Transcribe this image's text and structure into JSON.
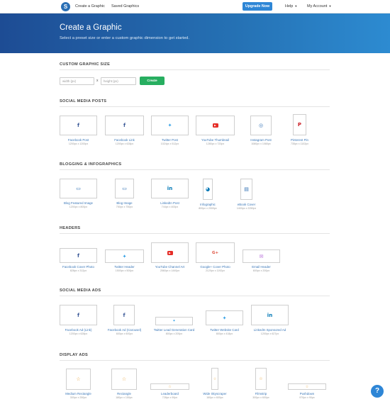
{
  "nav": {
    "logo": "S",
    "create": "Create a Graphic",
    "saved": "Saved Graphics",
    "upgrade": "Upgrade Now",
    "help": "Help",
    "account": "My Account"
  },
  "hero": {
    "title": "Create a Graphic",
    "subtitle": "Select a preset size or enter a custom graphic dimension to get started."
  },
  "custom": {
    "title": "CUSTOM GRAPHIC SIZE",
    "width_placeholder": "width (px)",
    "times": "x",
    "height_placeholder": "height (px)",
    "create": "Create"
  },
  "sections": {
    "social": {
      "title": "SOCIAL MEDIA POSTS",
      "items": [
        {
          "label": "Facebook Post",
          "dim": "1200px x 1200px",
          "icon": "facebook-icon"
        },
        {
          "label": "Facebook Link",
          "dim": "1200px x 628px",
          "icon": "facebook-icon"
        },
        {
          "label": "Twitter Post",
          "dim": "1024px x 512px",
          "icon": "twitter-icon"
        },
        {
          "label": "YouTube Thumbnail",
          "dim": "1280px x 720px",
          "icon": "youtube-icon"
        },
        {
          "label": "Instagram Post",
          "dim": "1080px x 1080px",
          "icon": "instagram-icon"
        },
        {
          "label": "Pinterest Pin",
          "dim": "735px x 1102px",
          "icon": "pinterest-icon"
        }
      ]
    },
    "blogging": {
      "title": "BLOGGING & INFOGRAPHICS",
      "items": [
        {
          "label": "Blog Featured Image",
          "dim": "1200px x 800px",
          "icon": "monitor-icon"
        },
        {
          "label": "Blog Image",
          "dim": "750px x 750px",
          "icon": "monitor-icon"
        },
        {
          "label": "LinkedIn Post",
          "dim": "744px x 400px",
          "icon": "linkedin-icon"
        },
        {
          "label": "Infographic",
          "dim": "800px x 2000px",
          "icon": "pie-chart-icon"
        },
        {
          "label": "eBook Cover",
          "dim": "1400px x 2250px",
          "icon": "book-icon"
        }
      ]
    },
    "headers": {
      "title": "HEADERS",
      "items": [
        {
          "label": "Facebook Cover Photo",
          "dim": "828px x 312px",
          "icon": "facebook-icon"
        },
        {
          "label": "Twitter Header",
          "dim": "1500px x 500px",
          "icon": "twitter-icon"
        },
        {
          "label": "YouTube Channel Art",
          "dim": "2560px x 1440px",
          "icon": "youtube-icon"
        },
        {
          "label": "Google+ Cover Photo",
          "dim": "2120px x 1192px",
          "icon": "google-plus-icon"
        },
        {
          "label": "Email Header",
          "dim": "600px x 200px",
          "icon": "email-icon"
        }
      ]
    },
    "ads": {
      "title": "SOCIAL MEDIA ADS",
      "items": [
        {
          "label": "Facebook Ad (Link)",
          "dim": "1200px x 628px",
          "icon": "facebook-icon"
        },
        {
          "label": "Facebook Ad (Carousel)",
          "dim": "600px x 600px",
          "icon": "facebook-icon"
        },
        {
          "label": "Twitter Lead Generation Card",
          "dim": "800px x 200px",
          "icon": "twitter-icon"
        },
        {
          "label": "Twitter Website Card",
          "dim": "800px x 418px",
          "icon": "twitter-icon"
        },
        {
          "label": "LinkedIn Sponsored Ad",
          "dim": "1200px x 627px",
          "icon": "linkedin-icon"
        }
      ]
    },
    "display": {
      "title": "DISPLAY ADS",
      "items": [
        {
          "label": "Medium Rectangle",
          "dim": "300px x 250px",
          "icon": "star-icon"
        },
        {
          "label": "Rectangle",
          "dim": "180px x 150px",
          "icon": "star-icon"
        },
        {
          "label": "Leaderboard",
          "dim": "728px x 90px",
          "icon": "star-icon"
        },
        {
          "label": "Wide Skyscraper",
          "dim": "160px x 600px",
          "icon": "star-icon"
        },
        {
          "label": "Filmstrip",
          "dim": "300px x 600px",
          "icon": "star-icon"
        },
        {
          "label": "Pushdown",
          "dim": "970px x 90px",
          "icon": "star-icon"
        }
      ]
    }
  },
  "help_button": "?"
}
